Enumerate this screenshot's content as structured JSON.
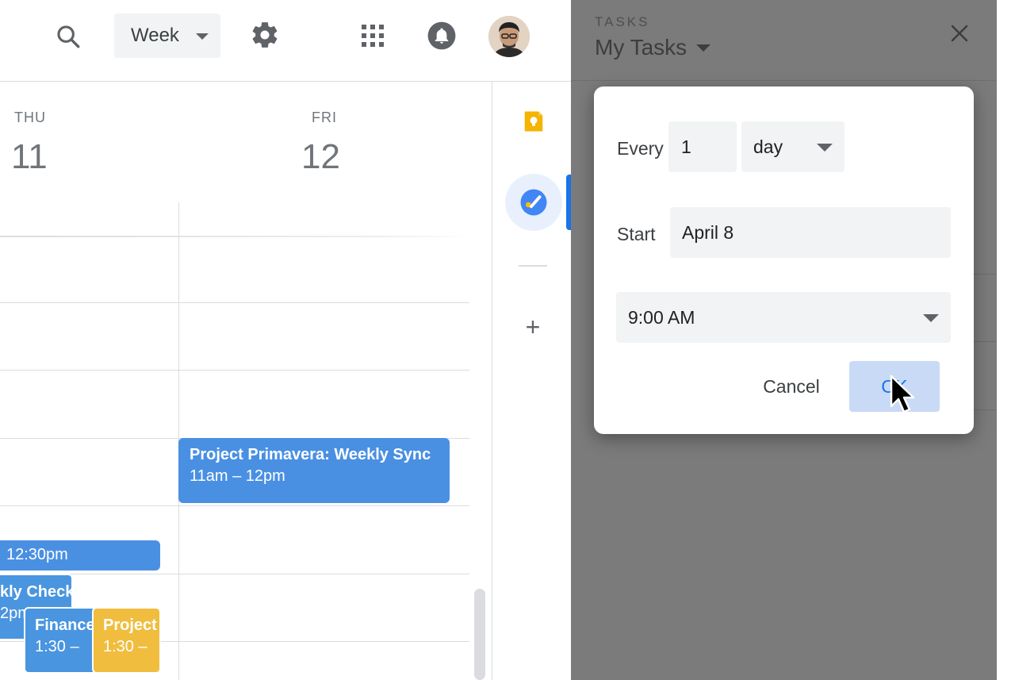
{
  "topbar": {
    "view_label": "Week"
  },
  "icons": {
    "search": "search-icon",
    "settings": "gear-icon",
    "apps": "apps-grid-icon",
    "notifications": "bell-icon",
    "keep": "keep-bulb-icon",
    "tasks": "tasks-check-icon",
    "add": "plus-icon",
    "close": "close-icon",
    "cursor": "mouse-pointer-icon"
  },
  "days": [
    {
      "name": "THU",
      "number": "11"
    },
    {
      "name": "FRI",
      "number": "12"
    }
  ],
  "events": [
    {
      "title": "Project Primavera: Weekly Sync",
      "time": "11am – 12pm"
    },
    {
      "title": "",
      "time": "12:30pm"
    },
    {
      "title": "kly Check",
      "time": "2pm"
    },
    {
      "title": "Finance",
      "time": "1:30 – "
    },
    {
      "title": "Project",
      "time": "1:30 – "
    }
  ],
  "sidebar": {
    "add_label": "+"
  },
  "tasks_panel": {
    "label": "TASKS",
    "list_name": "My Tasks"
  },
  "dialog": {
    "every_label": "Every",
    "every_value": "1",
    "unit_value": "day",
    "start_label": "Start",
    "start_value": "April 8",
    "time_value": "9:00 AM",
    "cancel_label": "Cancel",
    "ok_label": "OK"
  },
  "colors": {
    "event_blue": "#4a90e2",
    "event_yellow": "#f0bd3e",
    "accent": "#1a73e8",
    "overlay": "#7b7b7b"
  }
}
